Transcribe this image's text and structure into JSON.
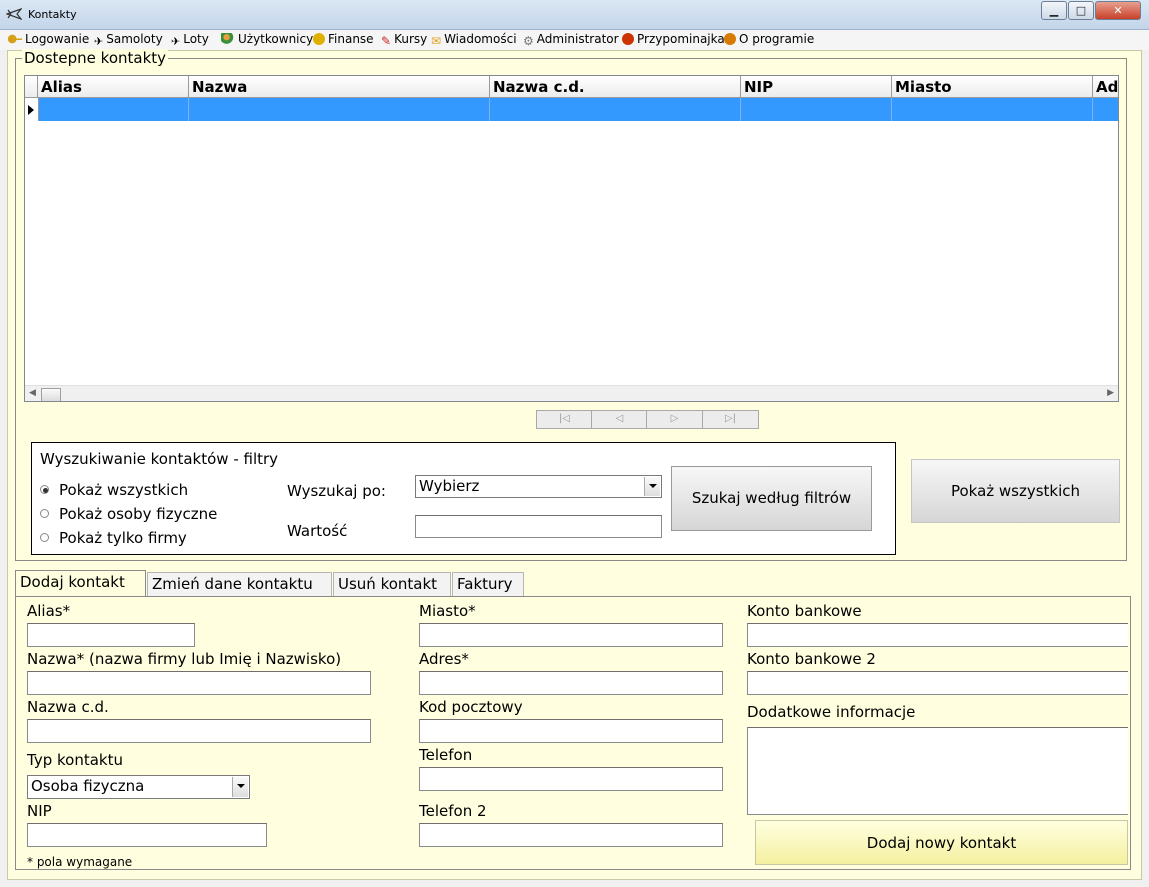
{
  "window": {
    "title": "Kontakty",
    "controls": {
      "minimize": "▁",
      "maximize": "□",
      "close": "✕"
    }
  },
  "menu": {
    "items": [
      {
        "label": "Logowanie",
        "icon": "key-icon",
        "color": "#d4a017"
      },
      {
        "label": "Samoloty",
        "icon": "plane-icon",
        "color": "#444444"
      },
      {
        "label": "Loty",
        "icon": "plane-icon",
        "color": "#444444"
      },
      {
        "label": "Użytkownicy",
        "icon": "users-icon",
        "color": "#3a8f3a"
      },
      {
        "label": "Finanse",
        "icon": "coin-icon",
        "color": "#e0b000"
      },
      {
        "label": "Kursy",
        "icon": "pen-icon",
        "color": "#cc2222"
      },
      {
        "label": "Wiadomości",
        "icon": "envelope-icon",
        "color": "#e6a020"
      },
      {
        "label": "Administrator",
        "icon": "admin-icon",
        "color": "#777777"
      },
      {
        "label": "Przypominajka",
        "icon": "clock-icon",
        "color": "#cc3300"
      },
      {
        "label": "O programie",
        "icon": "info-icon",
        "color": "#d97a00"
      }
    ]
  },
  "contacts": {
    "group_title": "Dostepne kontakty",
    "columns": [
      "Alias",
      "Nazwa",
      "Nazwa c.d.",
      "NIP",
      "Miasto",
      "Ad"
    ],
    "selected_row_color": "#3399ff"
  },
  "navigator": {
    "first": "|◁",
    "prev": "◁",
    "next": "▷",
    "last": "▷|"
  },
  "filters": {
    "title": "Wyszukiwanie kontaktów - filtry",
    "radios": [
      {
        "label": "Pokaż wszystkich",
        "checked": true
      },
      {
        "label": "Pokaż osoby fizyczne",
        "checked": false
      },
      {
        "label": "Pokaż tylko firmy",
        "checked": false
      }
    ],
    "search_by_label": "Wyszukaj po:",
    "search_by_value": "Wybierz",
    "value_label": "Wartość",
    "value_text": "",
    "search_button": "Szukaj według filtrów",
    "show_all_button": "Pokaż wszystkich"
  },
  "tabs": [
    "Dodaj kontakt",
    "Zmień dane kontaktu",
    "Usuń kontakt",
    "Faktury"
  ],
  "form": {
    "alias_label": "Alias*",
    "nazwa_label": "Nazwa* (nazwa firmy lub Imię i Nazwisko)",
    "nazwa_cd_label": "Nazwa c.d.",
    "typ_label": "Typ kontaktu",
    "typ_value": "Osoba fizyczna",
    "nip_label": "NIP",
    "required_note": "* pola wymagane",
    "miasto_label": "Miasto*",
    "adres_label": "Adres*",
    "kod_label": "Kod pocztowy",
    "telefon_label": "Telefon",
    "telefon2_label": "Telefon 2",
    "konto_label": "Konto bankowe",
    "konto2_label": "Konto bankowe 2",
    "info_label": "Dodatkowe informacje",
    "add_button": "Dodaj nowy kontakt"
  },
  "colors": {
    "panel_bg": "#ffffe0",
    "accent": "#3399ff"
  }
}
